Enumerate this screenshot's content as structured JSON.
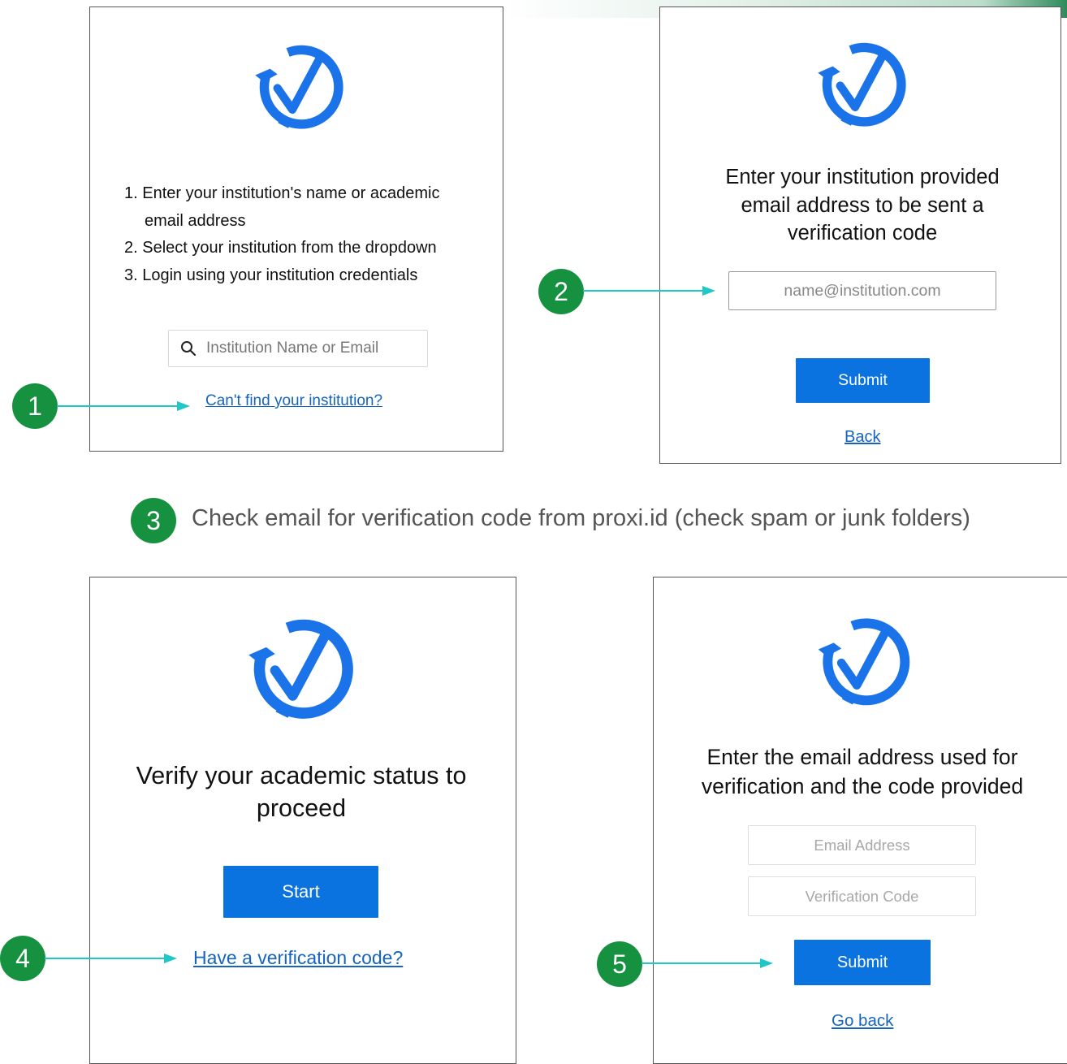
{
  "colors": {
    "brand_blue": "#0a73e0",
    "logo_blue": "#1a73e8",
    "link_blue": "#1565c0",
    "badge_green": "#16913f",
    "arrow_teal": "#1fc7c7"
  },
  "panel1": {
    "logo_icon": "check-circle-arrows-icon",
    "steps": [
      "1. Enter your institution's name or academic email address",
      "2. Select your institution from the dropdown",
      "3. Login using your institution credentials"
    ],
    "search_icon": "search-icon",
    "search_placeholder": "Institution Name or Email",
    "link": "Can't find your institution?"
  },
  "panel2": {
    "logo_icon": "check-circle-arrows-icon",
    "heading": "Enter your institution provided email address to be sent a verification code",
    "email_placeholder": "name@institution.com",
    "submit": "Submit",
    "back": "Back"
  },
  "caption": "Check email for verification code from proxi.id (check spam or junk folders)",
  "panel3": {
    "logo_icon": "check-circle-arrows-icon",
    "heading": "Verify your academic status to proceed",
    "start": "Start",
    "link": "Have a verification code?"
  },
  "panel4": {
    "logo_icon": "check-circle-arrows-icon",
    "heading": "Enter the email address used for verification and the code provided",
    "email_placeholder": "Email Address",
    "code_placeholder": "Verification Code",
    "submit": "Submit",
    "go_back": "Go back"
  },
  "badges": [
    "1",
    "2",
    "3",
    "4",
    "5"
  ]
}
